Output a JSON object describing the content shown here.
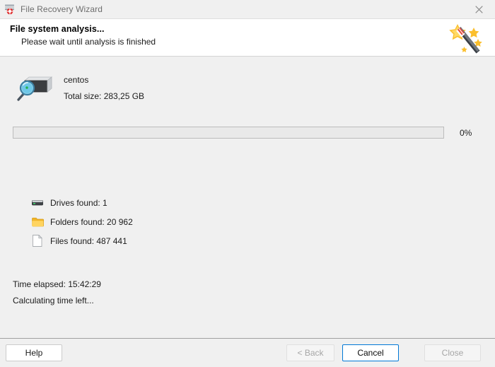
{
  "titlebar": {
    "title": "File Recovery Wizard",
    "icon": "recovery-disk-icon",
    "close_icon": "close-icon"
  },
  "header": {
    "title": "File system analysis...",
    "subtitle": "Please wait until analysis is finished",
    "icon": "magic-wand-icon"
  },
  "drive": {
    "icon": "disk-search-icon",
    "name": "centos",
    "size_label": "Total size: 283,25 GB"
  },
  "progress": {
    "percent": 0,
    "percent_label": "0%",
    "fill_color": "#06b025",
    "track_color": "#e9e9e9"
  },
  "stats": [
    {
      "icon": "drive-icon",
      "label": "Drives found: 1"
    },
    {
      "icon": "folder-icon",
      "label": "Folders found: 20 962"
    },
    {
      "icon": "file-icon",
      "label": "Files found: 487 441"
    }
  ],
  "time": {
    "elapsed": "Time elapsed: 15:42:29",
    "remaining": "Calculating time left..."
  },
  "footer": {
    "help": "Help",
    "back": "< Back",
    "cancel": "Cancel",
    "close": "Close",
    "focus_color": "#0078d7"
  }
}
